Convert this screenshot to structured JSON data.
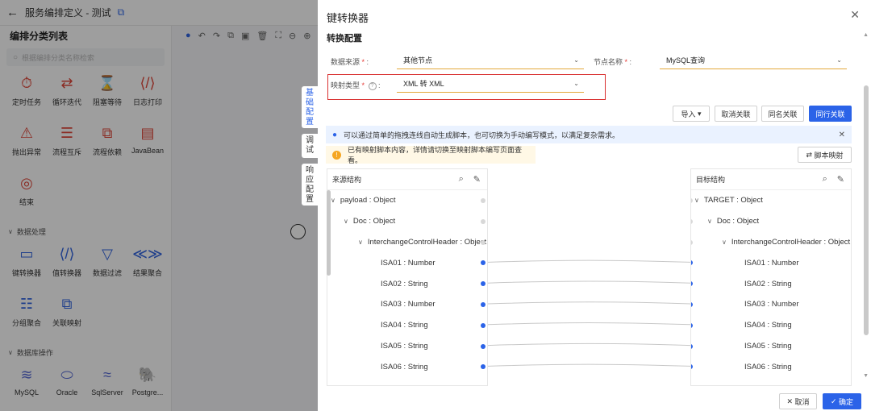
{
  "app": {
    "title": "服务编排定义 - 测试",
    "back_icon": "arrow-left-icon",
    "copy_icon": "copy-icon"
  },
  "sidebar": {
    "title": "编排分类列表",
    "search_placeholder": "根据编排分类名称检索",
    "nodes_top": [
      {
        "label": "定时任务",
        "icon": "clock-icon",
        "glyph": "⏱"
      },
      {
        "label": "循环迭代",
        "icon": "loop-icon",
        "glyph": "⇄"
      },
      {
        "label": "阻塞等待",
        "icon": "hourglass-icon",
        "glyph": "⌛"
      },
      {
        "label": "日志打印",
        "icon": "code-icon",
        "glyph": "⟨/⟩"
      },
      {
        "label": "抛出异常",
        "icon": "exception-icon",
        "glyph": "⚠"
      },
      {
        "label": "流程互斥",
        "icon": "mutex-icon",
        "glyph": "☰"
      },
      {
        "label": "流程依赖",
        "icon": "dependency-icon",
        "glyph": "⧉"
      },
      {
        "label": "JavaBean",
        "icon": "javabean-icon",
        "glyph": "▤"
      },
      {
        "label": "结束",
        "icon": "end-icon",
        "glyph": "◎"
      }
    ],
    "section_data": "数据处理",
    "nodes_data": [
      {
        "label": "键转换器",
        "icon": "key-converter-icon",
        "glyph": "▭"
      },
      {
        "label": "值转换器",
        "icon": "value-converter-icon",
        "glyph": "⟨/⟩"
      },
      {
        "label": "数据过滤",
        "icon": "filter-icon",
        "glyph": "▽"
      },
      {
        "label": "结果聚合",
        "icon": "aggregate-icon",
        "glyph": "≪≫"
      },
      {
        "label": "分组聚合",
        "icon": "group-icon",
        "glyph": "☷"
      },
      {
        "label": "关联映射",
        "icon": "mapping-icon",
        "glyph": "⧉"
      }
    ],
    "section_db": "数据库操作",
    "nodes_db": [
      {
        "label": "MySQL",
        "icon": "mysql-icon",
        "glyph": "≋"
      },
      {
        "label": "Oracle",
        "icon": "oracle-icon",
        "glyph": "⬭"
      },
      {
        "label": "SqlServer",
        "icon": "sqlserver-icon",
        "glyph": "≈"
      },
      {
        "label": "Postgre...",
        "icon": "postgres-icon",
        "glyph": "🐘"
      }
    ]
  },
  "side_tabs": [
    {
      "label": "基\n础\n配\n置"
    },
    {
      "label": "调\n试"
    },
    {
      "label": "响\n应\n配\n置"
    }
  ],
  "drawer": {
    "title": "键转换器",
    "section": "转换配置",
    "source_label": "数据来源",
    "source_value": "其他节点",
    "node_label": "节点名称",
    "node_value": "MySQL查询",
    "map_type_label": "映射类型",
    "map_type_value": "XML 转 XML",
    "buttons": {
      "import": "导入",
      "cancel_link": "取消关联",
      "same_name": "同名关联",
      "same_row": "同行关联",
      "script_map": "脚本映射"
    },
    "info_text": "可以通过简单的拖拽连线自动生成脚本，也可切换为手动编写模式，以满足复杂需求。",
    "warn_text": "已有映射脚本内容，详情请切换至映射脚本编写页面查看。",
    "source_panel_title": "来源结构",
    "target_panel_title": "目标结构",
    "source_tree": [
      "payload : Object",
      "Doc : Object",
      "InterchangeControlHeader : Object",
      "ISA01 : Number",
      "ISA02 : String",
      "ISA03 : Number",
      "ISA04 : String",
      "ISA05 : String",
      "ISA06 : String"
    ],
    "target_tree": [
      "TARGET : Object",
      "Doc : Object",
      "InterchangeControlHeader : Object",
      "ISA01 : Number",
      "ISA02 : String",
      "ISA03 : Number",
      "ISA04 : String",
      "ISA05 : String",
      "ISA06 : String"
    ],
    "footer": {
      "cancel": "取消",
      "confirm": "确定"
    }
  },
  "colors": {
    "primary": "#2b63e8",
    "highlight_border": "#d93030",
    "warning": "#f5a623"
  }
}
